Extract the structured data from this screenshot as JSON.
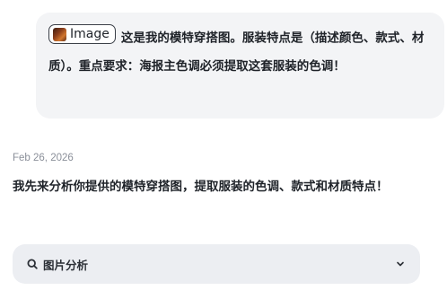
{
  "user_message": {
    "image_chip_label": "Image",
    "text": "这是我的模特穿搭图。服装特点是（描述颜色、款式、材质）。重点要求：海报主色调必须提取这套服装的色调！"
  },
  "timestamp": "Feb 26, 2026",
  "assistant_message": {
    "text": "我先来分析你提供的模特穿搭图，提取服装的色调、款式和材质特点！"
  },
  "analysis_panel": {
    "label": "图片分析",
    "icon": "search-icon",
    "toggle_icon": "chevron-down-icon"
  }
}
